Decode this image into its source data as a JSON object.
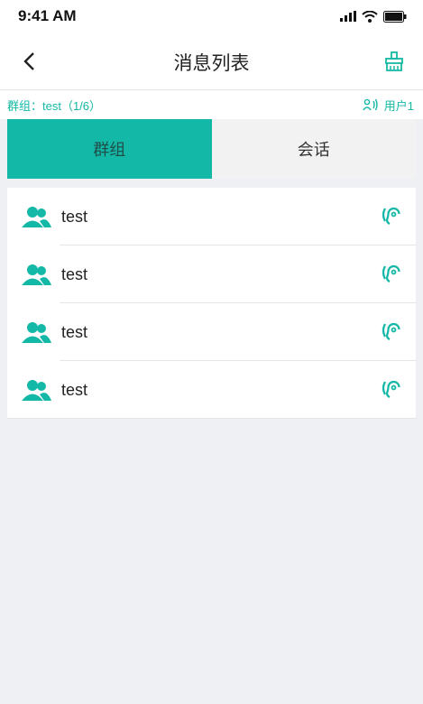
{
  "status_bar": {
    "time": "9:41 AM"
  },
  "nav": {
    "title": "消息列表"
  },
  "info_bar": {
    "group_text": "群组：test（1/6）",
    "user_text": "用户1"
  },
  "tabs": [
    {
      "label": "群组"
    },
    {
      "label": "会话"
    }
  ],
  "list": {
    "items": [
      {
        "label": "test"
      },
      {
        "label": "test"
      },
      {
        "label": "test"
      },
      {
        "label": "test"
      }
    ]
  },
  "colors": {
    "accent": "#14b8a6"
  }
}
